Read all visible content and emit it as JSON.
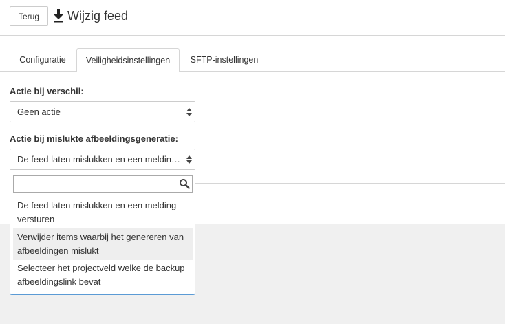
{
  "header": {
    "back_label": "Terug",
    "title": "Wijzig feed",
    "title_icon": "download-icon"
  },
  "tabs": [
    {
      "label": "Configuratie",
      "active": false
    },
    {
      "label": "Veiligheidsinstellingen",
      "active": true
    },
    {
      "label": "SFTP-instellingen",
      "active": false
    }
  ],
  "form": {
    "diff_action": {
      "label": "Actie bij verschil:",
      "selected": "Geen actie"
    },
    "image_fail_action": {
      "label": "Actie bij mislukte afbeeldingsgeneratie:",
      "selected": "De feed laten mislukken en een melding versturen",
      "dropdown": {
        "search_value": "",
        "options": [
          "De feed laten mislukken en een melding versturen",
          "Verwijder items waarbij het genereren van afbeeldingen mislukt",
          "Selecteer het projectveld welke de backup afbeeldingslink bevat"
        ],
        "highlighted_index": 1
      }
    }
  },
  "colors": {
    "focus_border": "#5b9bd5",
    "highlight": "#eeeeee",
    "background": "#f0f0f0"
  }
}
